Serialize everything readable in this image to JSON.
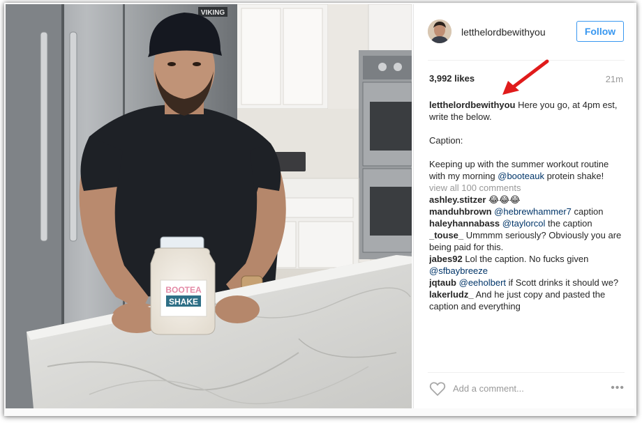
{
  "post": {
    "username": "letthelordbewithyou",
    "follow_label": "Follow",
    "likes": "3,992 likes",
    "time_ago": "21m",
    "caption_lines": [
      {
        "user": "letthelordbewithyou",
        "text": " Here you go, at 4pm est, write the below."
      },
      {
        "text": "Caption:"
      },
      {
        "pre": "Keeping up with the summer workout routine with my morning ",
        "mention": "@booteauk",
        "post": " protein shake!"
      }
    ],
    "view_all": "view all 100 comments",
    "comments": [
      {
        "user": "ashley.stitzer",
        "pre": " ",
        "emoji": "😂😂😂",
        "mention": "",
        "post": ""
      },
      {
        "user": "manduhbrown",
        "pre": " ",
        "mention": "@hebrewhammer7",
        "post": " caption"
      },
      {
        "user": "haleyhannabass",
        "pre": " ",
        "mention": "@taylorcol",
        "post": " the caption"
      },
      {
        "user": "_touse_",
        "pre": " Ummmm seriously? Obviously you are being paid for this.",
        "mention": "",
        "post": ""
      },
      {
        "user": "jabes92",
        "pre": " Lol the caption. No fucks given ",
        "mention": "@sfbaybreeze",
        "post": ""
      },
      {
        "user": "jqtaub",
        "pre": " ",
        "mention": "@eeholbert",
        "post": " if Scott drinks it should we?"
      },
      {
        "user": "lakerludz_",
        "pre": " And he just copy and pasted the caption and everything",
        "mention": "",
        "post": ""
      }
    ],
    "add_comment_placeholder": "Add a comment...",
    "more_label": "•••"
  },
  "photo": {
    "fridge_brand": "VIKING",
    "jar_brand_top": "BOOTEA",
    "jar_brand_bottom": "SHAKE"
  },
  "colors": {
    "accent": "#3897f0",
    "mention": "#003569",
    "annotation_arrow": "#e01b1b"
  },
  "icons": {
    "heart": "heart-icon",
    "more": "more-options-icon",
    "annotation": "red-arrow"
  }
}
